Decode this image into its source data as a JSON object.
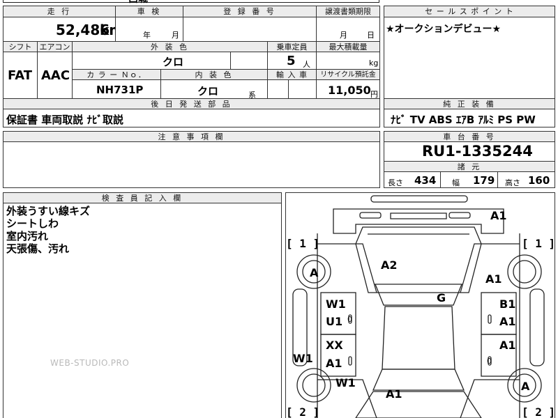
{
  "header": {
    "mileage_label": "走 行",
    "inspection_label": "車 検",
    "reg_label": "登 録 番 号",
    "transfer_label": "譲渡書類期限",
    "points_label": "セ ー ル ス ポ イ ン ト",
    "top_partial": "西城"
  },
  "mileage": {
    "value": "52,486",
    "unit": "km"
  },
  "inspection": {
    "year_label": "年",
    "month_label": "月"
  },
  "transfer": {
    "month_label": "月",
    "day_label": "日"
  },
  "sales_point": "★オークションデビュー★",
  "row2": {
    "shift_label": "シフト",
    "ac_label": "エアコン",
    "exterior_label": "外 装 色",
    "capacity_label": "乗車定員",
    "maxload_label": "最大積載量",
    "shift": "FAT",
    "ac": "AAC",
    "exterior_color": "クロ",
    "capacity": "5",
    "capacity_unit": "人",
    "maxload_unit": "kg"
  },
  "row3": {
    "colorno_label": "カ ラ ー Ｎｏ．",
    "interior_label": "内 装 色",
    "import_label": "輸 入 車",
    "recycle_label": "リサイクル預託金",
    "color_no": "NH731P",
    "interior_color": "クロ",
    "interior_suffix": "系",
    "recycle_fee": "11,050",
    "recycle_unit": "円"
  },
  "later_parts": {
    "label": "後 日 発 送 部 品",
    "value": "保証書 車両取説 ﾅﾋﾞ取説"
  },
  "equipment": {
    "label": "純 正 装 備",
    "value": "ﾅﾋﾞ TV ABS ｴｱB ｱﾙﾐ PS PW"
  },
  "caution": {
    "label": "注 意 事 項 欄"
  },
  "chassis": {
    "label": "車 台 番 号",
    "value": "RU1-1335244"
  },
  "dimensions": {
    "label": "諸 元",
    "length_label": "長さ",
    "length": "434",
    "width_label": "幅",
    "width": "179",
    "height_label": "高さ",
    "height": "160"
  },
  "inspector": {
    "label": "検 査 員 記 入 欄",
    "lines": [
      "外装うすい線キズ",
      "シートしわ",
      "室内汚れ",
      "天張傷、汚れ"
    ]
  },
  "diagram": {
    "marks": {
      "front_a1": "A1",
      "hood_a2": "A2",
      "roof_g": "G",
      "fl_wheel_a": "A",
      "fr_fender_a1": "A1",
      "left_front_door_w1": "W1",
      "left_front_door_u1": "U1",
      "right_front_door_b1": "B1",
      "right_front_door_a1": "A1",
      "left_rear_door_xx": "XX",
      "left_rear_door_a1": "A1",
      "right_rear_door_a1": "A1",
      "left_sill_w1": "W1",
      "left_rear_fender_w1": "W1",
      "rr_wheel_a": "A",
      "rear_a1": "A1"
    },
    "bracket_1": "[ 1 ]",
    "bracket_2": "[ 2 ]",
    "glyph_zero": "0"
  },
  "watermark": "WEB-STUDIO.PRO"
}
